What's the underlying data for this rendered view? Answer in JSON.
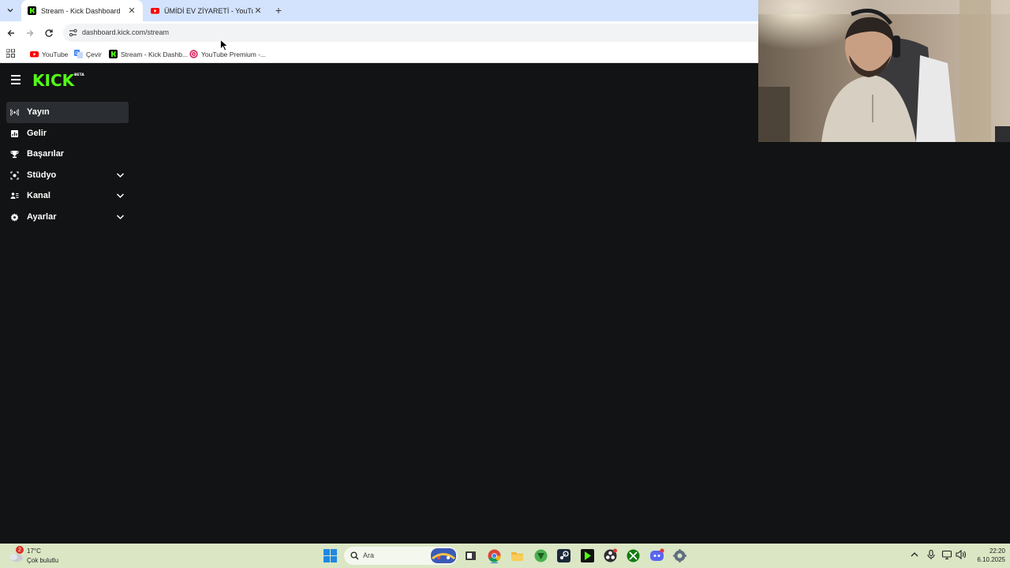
{
  "browser": {
    "tabs": [
      {
        "title": "Stream - Kick Dashboard",
        "active": true,
        "favicon": "kick-icon"
      },
      {
        "title": "ÜMİDİ EV ZİYARETİ - YouTube",
        "active": false,
        "favicon": "youtube-icon"
      }
    ],
    "url": "dashboard.kick.com/stream",
    "bookmarks": [
      {
        "label": "YouTube",
        "icon": "youtube-icon"
      },
      {
        "label": "Çevir",
        "icon": "translate-icon"
      },
      {
        "label": "Stream - Kick Dashb...",
        "icon": "kick-icon"
      },
      {
        "label": "YouTube Premium -...",
        "icon": "youtube-premium-icon"
      }
    ]
  },
  "app": {
    "logo": "KICK",
    "logo_badge": "BETA",
    "nav": [
      {
        "label": "Yayın",
        "icon": "broadcast-icon",
        "selected": true,
        "expandable": false
      },
      {
        "label": "Gelir",
        "icon": "revenue-icon",
        "selected": false,
        "expandable": false
      },
      {
        "label": "Başarılar",
        "icon": "trophy-icon",
        "selected": false,
        "expandable": false
      },
      {
        "label": "Stüdyo",
        "icon": "studio-icon",
        "selected": false,
        "expandable": true
      },
      {
        "label": "Kanal",
        "icon": "channel-icon",
        "selected": false,
        "expandable": true
      },
      {
        "label": "Ayarlar",
        "icon": "gear-icon",
        "selected": false,
        "expandable": true
      }
    ],
    "accent": "#53fc18"
  },
  "taskbar": {
    "weather": {
      "temp": "17°C",
      "condition": "Çok bulutlu",
      "badge": "2"
    },
    "search_placeholder": "Ara",
    "clock": {
      "time": "22:20",
      "date": "6.10.2025"
    }
  }
}
